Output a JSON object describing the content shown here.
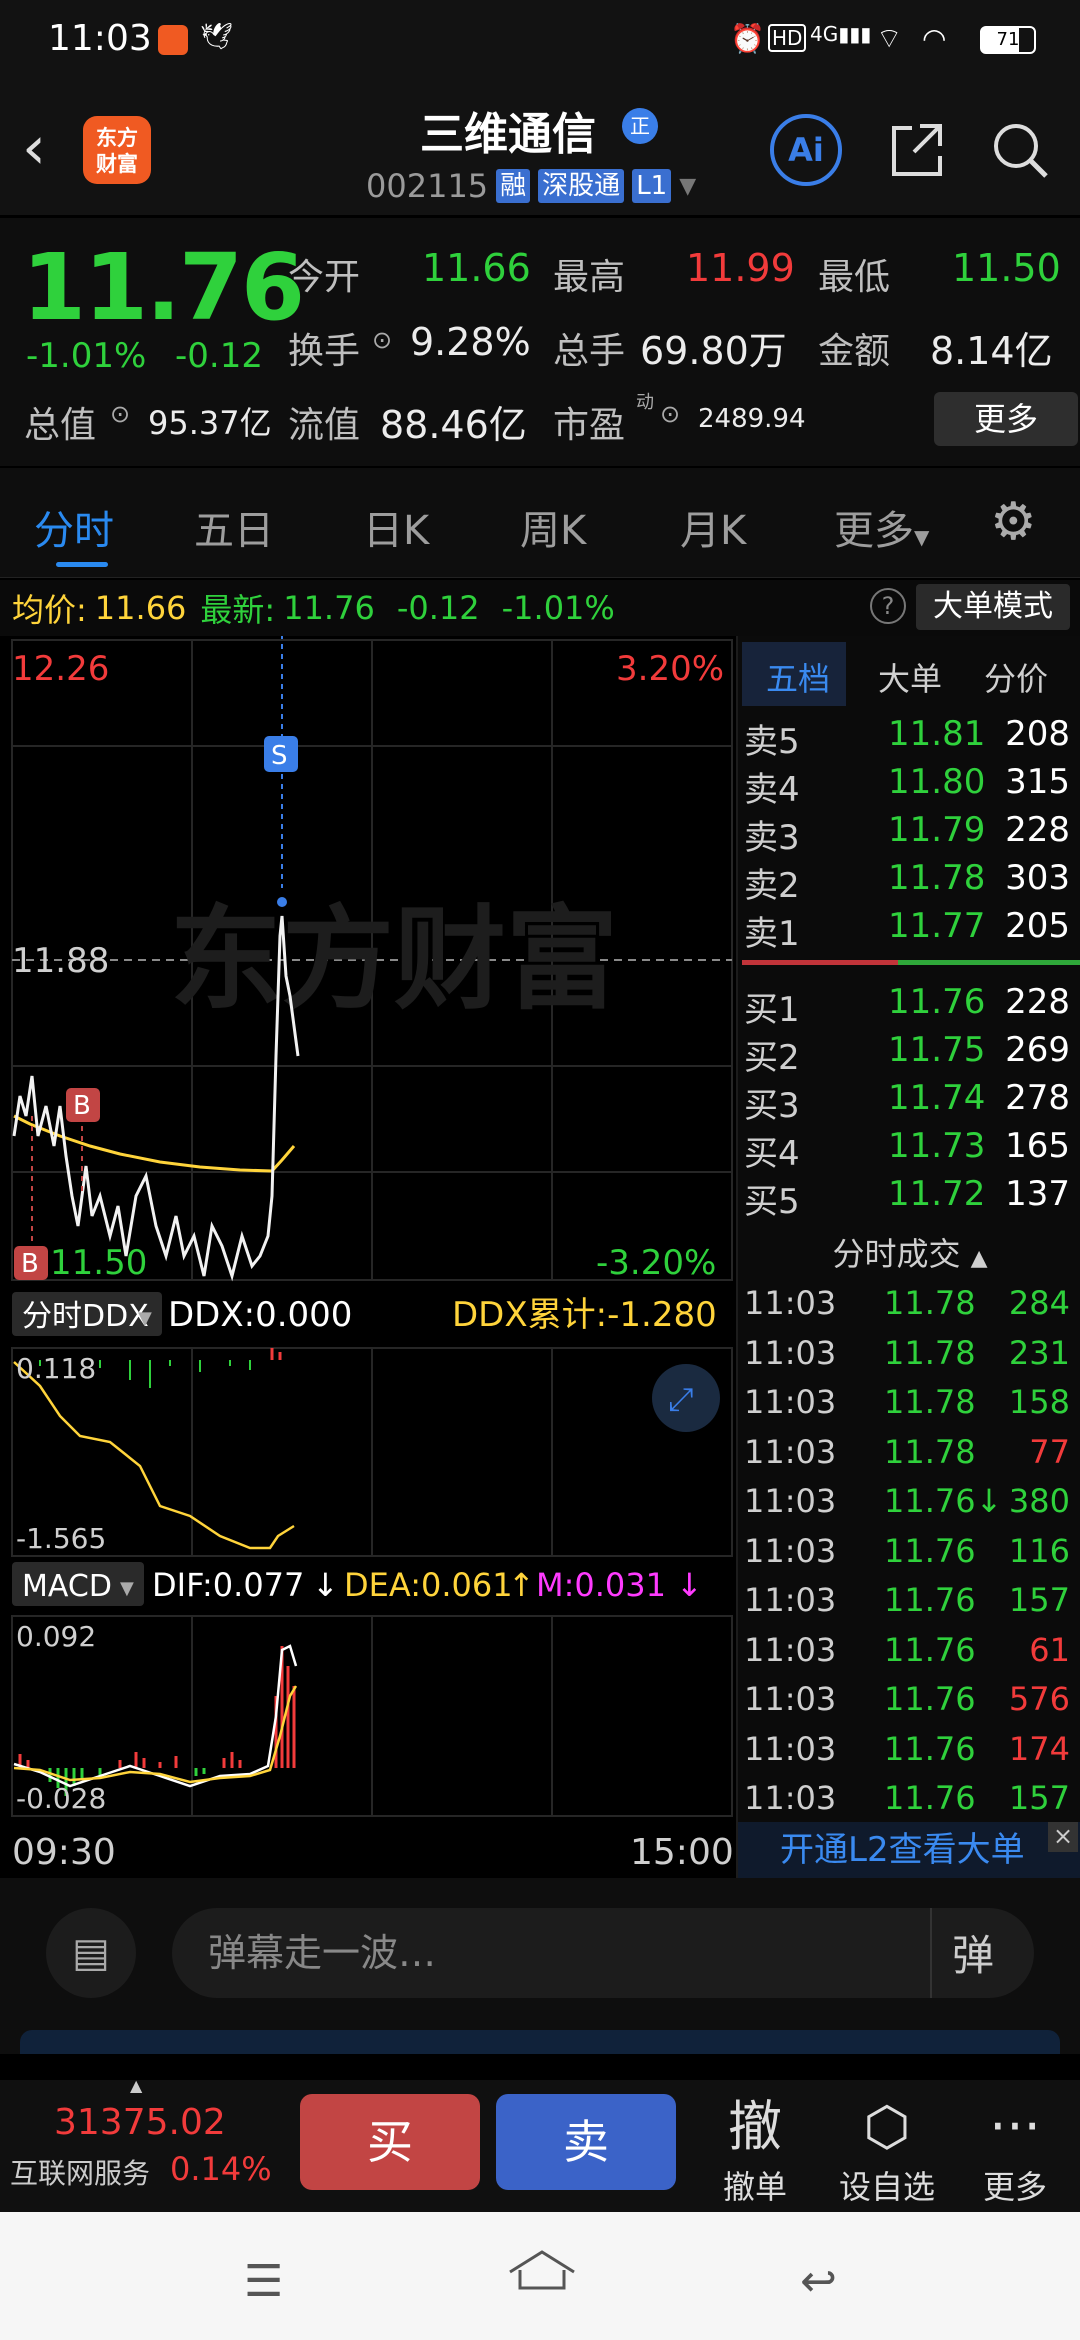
{
  "status_bar": {
    "time": "11:03",
    "battery": "71",
    "network": "4G"
  },
  "header": {
    "stock_name": "三维通信",
    "badge": "正",
    "stock_code": "002115",
    "tags": [
      "融",
      "深股通",
      "L1"
    ],
    "logo_text": "东方财富",
    "ai_label": "Ai"
  },
  "quote": {
    "price": "11.76",
    "change_pct": "-1.01%",
    "change": "-0.12",
    "open_label": "今开",
    "open": "11.66",
    "high_label": "最高",
    "high": "11.99",
    "low_label": "最低",
    "low": "11.50",
    "turnover_label": "换手",
    "turnover": "9.28%",
    "volume_label": "总手",
    "volume": "69.80万",
    "amount_label": "金额",
    "amount": "8.14亿",
    "mktcap_label": "总值",
    "mktcap": "95.37亿",
    "float_label": "流值",
    "float": "88.46亿",
    "pe_label": "市盈",
    "pe_sup": "动",
    "pe": "2489.94",
    "more": "更多"
  },
  "tabs": [
    "分时",
    "五日",
    "日K",
    "周K",
    "月K",
    "更多"
  ],
  "info_strip": {
    "avg_label": "均价:",
    "avg": "11.66",
    "latest_label": "最新:",
    "latest": "11.76",
    "chg": "-0.12",
    "pct": "-1.01%",
    "mode_button": "大单模式"
  },
  "chart": {
    "y_top": "12.26",
    "y_mid": "11.88",
    "y_bottom": "11.50",
    "pct_top": "3.20%",
    "pct_bottom": "-3.20%",
    "ddx_select": "分时DDX",
    "ddx": "DDX:0.000",
    "ddx_cum": "DDX累计:-1.280",
    "ddx_top": "0.118",
    "ddx_bottom": "-1.565",
    "macd_select": "MACD",
    "dif": "DIF:0.077",
    "dea": "DEA:0.061",
    "m": "M:0.031",
    "macd_top": "0.092",
    "macd_bottom": "-0.028",
    "time_start": "09:30",
    "time_end": "15:00",
    "watermark": "东方财富",
    "marker_s": "S",
    "marker_b": "B"
  },
  "order_book": {
    "tabs": [
      "五档",
      "大单",
      "分价"
    ],
    "asks": [
      {
        "label": "卖5",
        "price": "11.81",
        "vol": "208"
      },
      {
        "label": "卖4",
        "price": "11.80",
        "vol": "315"
      },
      {
        "label": "卖3",
        "price": "11.79",
        "vol": "228"
      },
      {
        "label": "卖2",
        "price": "11.78",
        "vol": "303"
      },
      {
        "label": "卖1",
        "price": "11.77",
        "vol": "205"
      }
    ],
    "bids": [
      {
        "label": "买1",
        "price": "11.76",
        "vol": "228"
      },
      {
        "label": "买2",
        "price": "11.75",
        "vol": "269"
      },
      {
        "label": "买3",
        "price": "11.74",
        "vol": "278"
      },
      {
        "label": "买4",
        "price": "11.73",
        "vol": "165"
      },
      {
        "label": "买5",
        "price": "11.72",
        "vol": "137"
      }
    ],
    "trades_title": "分时成交",
    "trades": [
      {
        "time": "11:03",
        "price": "11.78",
        "vol": "284",
        "dir": "buy"
      },
      {
        "time": "11:03",
        "price": "11.78",
        "vol": "231",
        "dir": "buy"
      },
      {
        "time": "11:03",
        "price": "11.78",
        "vol": "158",
        "dir": "buy"
      },
      {
        "time": "11:03",
        "price": "11.78",
        "vol": "77",
        "dir": "sell"
      },
      {
        "time": "11:03",
        "price": "11.76↓",
        "vol": "380",
        "dir": "buy"
      },
      {
        "time": "11:03",
        "price": "11.76",
        "vol": "116",
        "dir": "buy"
      },
      {
        "time": "11:03",
        "price": "11.76",
        "vol": "157",
        "dir": "buy"
      },
      {
        "time": "11:03",
        "price": "11.76",
        "vol": "61",
        "dir": "sell"
      },
      {
        "time": "11:03",
        "price": "11.76",
        "vol": "576",
        "dir": "sell"
      },
      {
        "time": "11:03",
        "price": "11.76",
        "vol": "174",
        "dir": "sell"
      },
      {
        "time": "11:03",
        "price": "11.76",
        "vol": "157",
        "dir": "buy"
      }
    ],
    "l2_banner": "开通L2查看大单"
  },
  "comment": {
    "placeholder": "弹幕走一波…",
    "danmu_icon": "弹"
  },
  "bottom_bar": {
    "index_value": "31375.02",
    "index_name": "互联网服务",
    "index_pct": "0.14%",
    "buy": "买",
    "sell": "卖",
    "cancel_icon": "撤",
    "cancel": "撤单",
    "watch": "设自选",
    "more": "更多"
  },
  "colors": {
    "up": "#f23b3b",
    "down": "#2fd13c",
    "accent": "#2a8af0"
  }
}
